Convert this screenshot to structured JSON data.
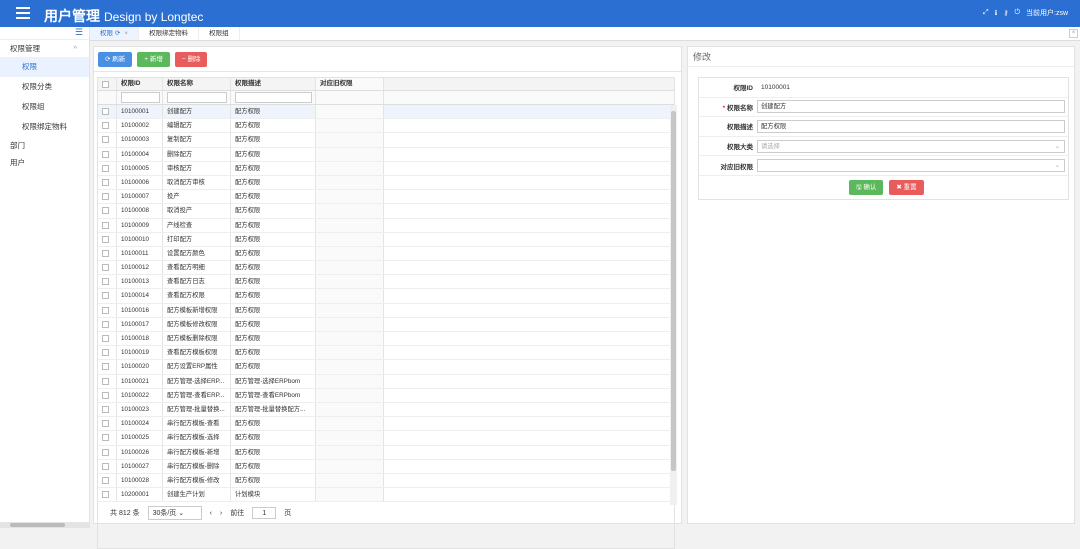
{
  "header": {
    "title": "用户管理",
    "subtitle": "Design by Longtec",
    "user": "当前用户:zsw"
  },
  "sidebar": {
    "groups": [
      {
        "label": "权限管理",
        "items": [
          "权限",
          "权限分类",
          "权限组",
          "权限绑定物料"
        ]
      },
      {
        "label": "部门"
      },
      {
        "label": "用户"
      }
    ]
  },
  "tabs": [
    {
      "label": "权限",
      "active": true
    },
    {
      "label": "权限绑定物料"
    },
    {
      "label": "权限组"
    }
  ],
  "toolbar": {
    "refresh": "刷新",
    "add": "新增",
    "delete": "删除"
  },
  "table": {
    "columns": [
      "权限ID",
      "权限名称",
      "权限描述",
      "对应旧权限"
    ],
    "rows": [
      [
        "10100001",
        "创建配方",
        "配方权限"
      ],
      [
        "10100002",
        "编辑配方",
        "配方权限"
      ],
      [
        "10100003",
        "复制配方",
        "配方权限"
      ],
      [
        "10100004",
        "删除配方",
        "配方权限"
      ],
      [
        "10100005",
        "审核配方",
        "配方权限"
      ],
      [
        "10100006",
        "取消配方审核",
        "配方权限"
      ],
      [
        "10100007",
        "投产",
        "配方权限"
      ],
      [
        "10100008",
        "取消投产",
        "配方权限"
      ],
      [
        "10100009",
        "产线检查",
        "配方权限"
      ],
      [
        "10100010",
        "打印配方",
        "配方权限"
      ],
      [
        "10100011",
        "设置配方颜色",
        "配方权限"
      ],
      [
        "10100012",
        "查看配方明细",
        "配方权限"
      ],
      [
        "10100013",
        "查看配方日志",
        "配方权限"
      ],
      [
        "10100014",
        "查看配方权限",
        "配方权限"
      ],
      [
        "10100016",
        "配方模板新增权限",
        "配方权限"
      ],
      [
        "10100017",
        "配方模板修改权限",
        "配方权限"
      ],
      [
        "10100018",
        "配方模板删除权限",
        "配方权限"
      ],
      [
        "10100019",
        "查看配方模板权限",
        "配方权限"
      ],
      [
        "10100020",
        "配方设置ERP属性",
        "配方权限"
      ],
      [
        "10100021",
        "配方管理-选择ERP...",
        "配方管理-选择ERPbom"
      ],
      [
        "10100022",
        "配方管理-查看ERP...",
        "配方管理-查看ERPbom"
      ],
      [
        "10100023",
        "配方管理-批量替换...",
        "配方管理-批量替换配方..."
      ],
      [
        "10100024",
        "串行配方模板-查看",
        "配方权限"
      ],
      [
        "10100025",
        "串行配方模板-选择",
        "配方权限"
      ],
      [
        "10100026",
        "串行配方模板-新增",
        "配方权限"
      ],
      [
        "10100027",
        "串行配方模板-删除",
        "配方权限"
      ],
      [
        "10100028",
        "串行配方模板-修改",
        "配方权限"
      ],
      [
        "10200001",
        "创建生产计划",
        "计划模块"
      ]
    ]
  },
  "pager": {
    "total": "共 812 条",
    "size": "30条/页",
    "goto": "前往",
    "page": "1",
    "unit": "页"
  },
  "form": {
    "title": "修改",
    "id_label": "权限ID",
    "id_value": "10100001",
    "name_label": "权限名称",
    "name_value": "创建配方",
    "desc_label": "权限描述",
    "desc_value": "配方权限",
    "cat_label": "权限大类",
    "cat_placeholder": "请选择",
    "old_label": "对应旧权限",
    "confirm": "确认",
    "reset": "重置"
  }
}
